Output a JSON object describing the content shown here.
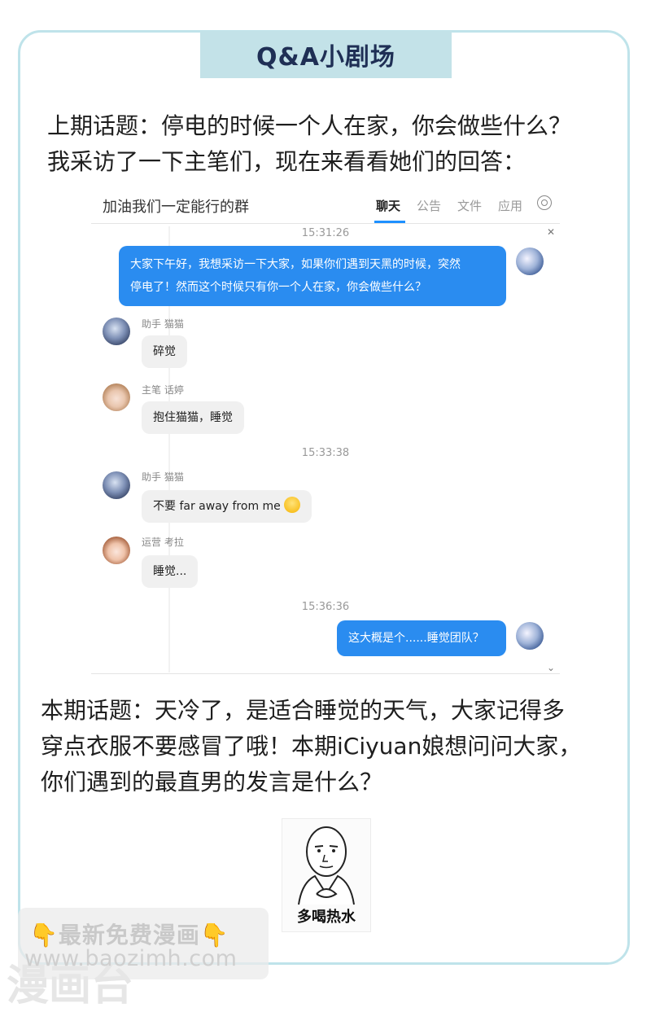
{
  "banner": {
    "title": "Q&A小剧场"
  },
  "intro": {
    "lines": [
      "上期话题：停电的时候一个人在家，你会做些什么？",
      "我采访了一下主笔们，现在来看看她们的回答："
    ]
  },
  "chat": {
    "group_name": "加油我们一定能行的群",
    "tabs": [
      "聊天",
      "公告",
      "文件",
      "应用"
    ],
    "active_tab": "聊天",
    "timestamps": [
      "15:31:26",
      "15:33:38",
      "15:36:36"
    ],
    "messages": [
      {
        "from": "self",
        "lines": [
          "大家下午好，我想采访一下大家，如果你们遇到天黑的时候，突然",
          "停电了！然而这个时候只有你一个人在家，你会做些什么？"
        ]
      },
      {
        "sender": "助手 猫猫",
        "text": "碎觉"
      },
      {
        "sender": "主笔 话婷",
        "text": "抱住猫猫，睡觉"
      },
      {
        "sender": "助手 猫猫",
        "text": "不要 far away from me"
      },
      {
        "sender": "运营 考拉",
        "text": "睡觉..."
      },
      {
        "from": "self",
        "text": "这大概是个......睡觉团队？"
      }
    ]
  },
  "topic": {
    "lines": [
      "本期话题：天冷了，是适合睡觉的天气，大家记得多",
      "穿点衣服不要感冒了哦！本期iCiyuan娘想问问大家，",
      "你们遇到的最直男的发言是什么？"
    ]
  },
  "meme": {
    "caption": "多喝热水"
  },
  "watermark": {
    "line1": "👇最新免费漫画👇",
    "line2": "www.baozimh.com",
    "big": "漫画台"
  },
  "colors": {
    "banner_bg": "#c3e2e8",
    "card_border": "#bfe3ea",
    "bubble_out": "#2a8cf0",
    "bubble_in": "#f0f0f0"
  }
}
